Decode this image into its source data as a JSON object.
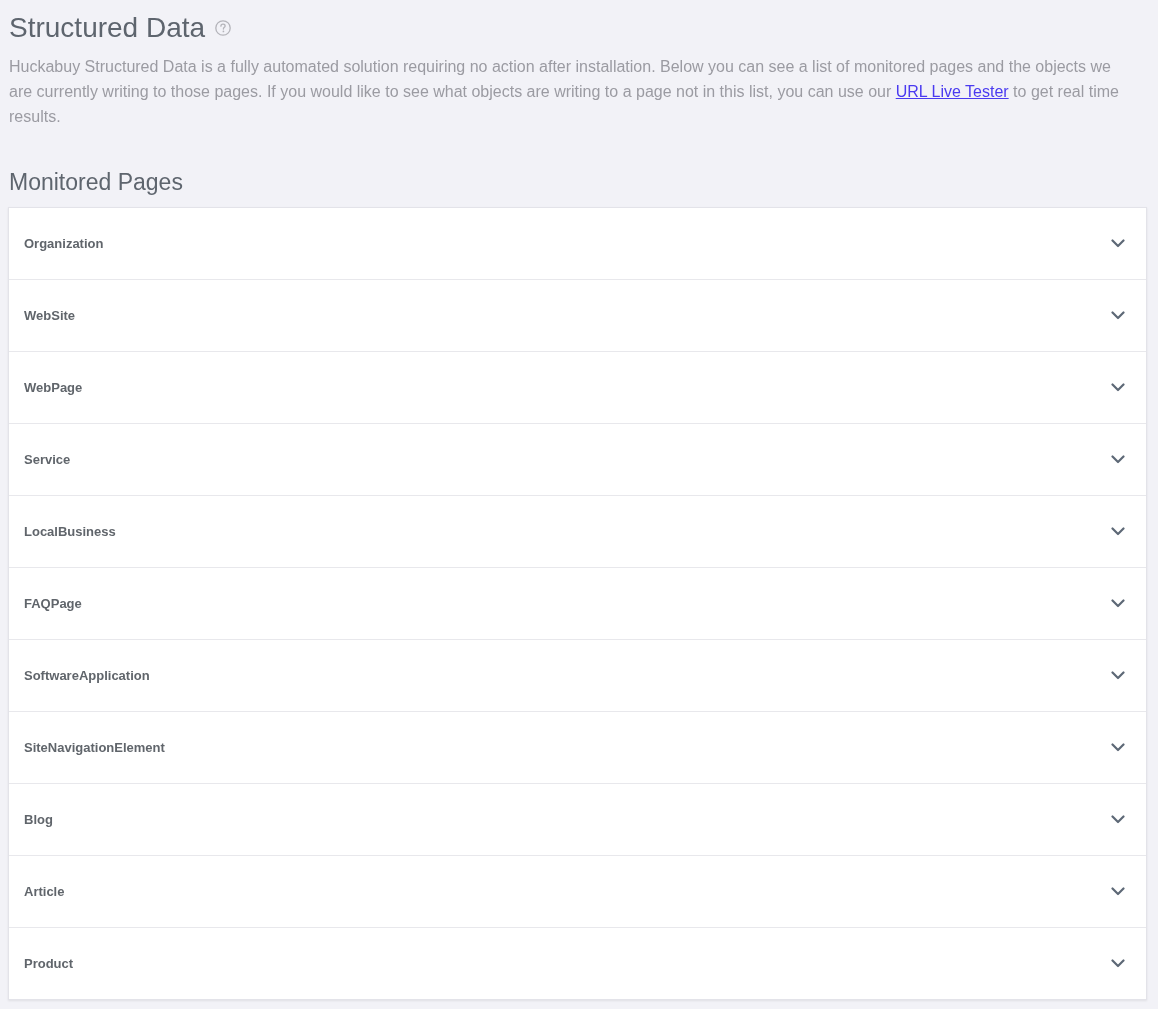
{
  "header": {
    "title": "Structured Data",
    "description": {
      "before": "Huckabuy Structured Data is a fully automated solution requiring no action after installation. Below you can see a list of monitored pages and the objects we are currently writing to those pages. If you would like to see what objects are writing to a page not in this list, you can use our ",
      "link": "URL Live Tester",
      "after": " to get real time results."
    }
  },
  "section": {
    "title": "Monitored Pages"
  },
  "pages": [
    {
      "label": "Organization",
      "expanded": false
    },
    {
      "label": "WebSite",
      "expanded": false
    },
    {
      "label": "WebPage",
      "expanded": false
    },
    {
      "label": "Service",
      "expanded": false
    },
    {
      "label": "LocalBusiness",
      "expanded": false
    },
    {
      "label": "FAQPage",
      "expanded": false
    },
    {
      "label": "SoftwareApplication",
      "expanded": false
    },
    {
      "label": "SiteNavigationElement",
      "expanded": false
    },
    {
      "label": "Blog",
      "expanded": false
    },
    {
      "label": "Article",
      "expanded": false
    },
    {
      "label": "Product",
      "expanded": false
    }
  ]
}
